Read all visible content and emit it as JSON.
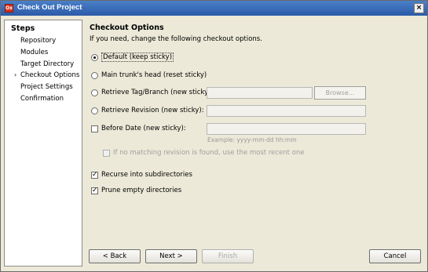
{
  "window": {
    "title": "Check Out Project",
    "app_icon_text": "Ox",
    "close_label": "×"
  },
  "steps": {
    "heading": "Steps",
    "current_marker": "›",
    "items": [
      {
        "label": "Repository"
      },
      {
        "label": "Modules"
      },
      {
        "label": "Target Directory"
      },
      {
        "label": "Checkout Options",
        "current": true
      },
      {
        "label": "Project Settings"
      },
      {
        "label": "Confirmation"
      }
    ]
  },
  "content": {
    "heading": "Checkout Options",
    "subtitle": "If you need, change the following checkout options.",
    "options": {
      "default": {
        "label": "Default (keep sticky)",
        "selected": true
      },
      "main_trunk": {
        "label": "Main trunk's head (reset sticky)",
        "selected": false
      },
      "retrieve_tag": {
        "label": "Retrieve Tag/Branch (new sticky):",
        "selected": false,
        "value": ""
      },
      "browse_label": "Browse...",
      "retrieve_revision": {
        "label": "Retrieve Revision (new sticky):",
        "selected": false,
        "value": ""
      },
      "before_date": {
        "label": "Before Date (new sticky):",
        "checked": false,
        "value": ""
      },
      "date_hint": "Example: yyyy-mm-dd hh:mm",
      "no_match": {
        "label": "If no matching revision is found, use the most recent one",
        "checked": false,
        "enabled": false
      },
      "recurse": {
        "label": "Recurse into subdirectories",
        "checked": true
      },
      "prune": {
        "label": "Prune empty directories",
        "checked": true
      }
    }
  },
  "buttons": {
    "back": "< Back",
    "next": "Next >",
    "finish": "Finish",
    "cancel": "Cancel"
  },
  "check_mark": "✓"
}
